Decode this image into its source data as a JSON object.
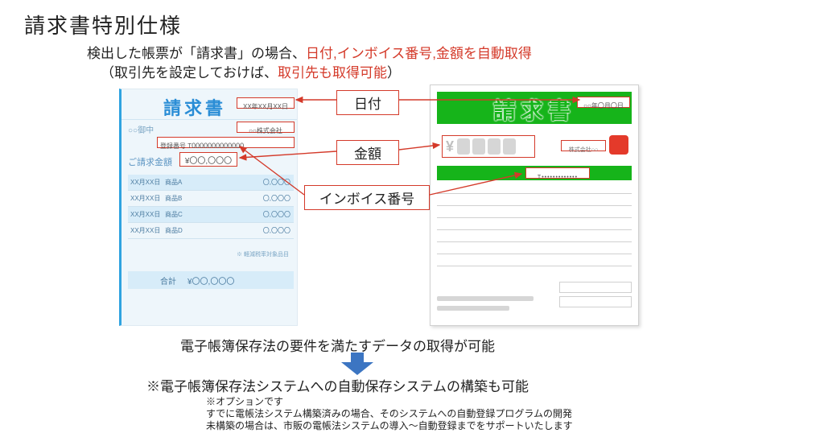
{
  "title": "請求書特別仕様",
  "intro": {
    "line1_pre": "検出した帳票が「請求書」の場合、",
    "line1_red": "日付,インボイス番号,金額を自動取得",
    "line2_pre": "（取引先を設定しておけば、",
    "line2_red": "取引先も取得可能",
    "line2_post": "）"
  },
  "labels": {
    "date": "日付",
    "amount": "金額",
    "invoice_no": "インボイス番号"
  },
  "blue": {
    "title": "請求書",
    "addressee": "○○御中",
    "date": "XX年XX月XX日",
    "company": "○○株式会社",
    "reg_prefix": "登録番号 T",
    "reg_number": "0000000000000",
    "billed_label": "ご請求金額",
    "billed_amount": "¥〇〇,〇〇〇",
    "rows": [
      {
        "date": "XX月XX日",
        "item": "商品A",
        "amt": "〇,〇〇〇"
      },
      {
        "date": "XX月XX日",
        "item": "商品B",
        "amt": "〇,〇〇〇"
      },
      {
        "date": "XX月XX日",
        "item": "商品C",
        "amt": "〇,〇〇〇"
      },
      {
        "date": "XX月XX日",
        "item": "商品D",
        "amt": "〇,〇〇〇"
      }
    ],
    "note": "※ 軽減税率対象品目",
    "total_label": "合計",
    "total": "¥〇〇,〇〇〇"
  },
  "green": {
    "title": "請求書",
    "date": "○○年〇月〇日",
    "company": "株式会社○○",
    "yen": "¥",
    "invoice_dots": "T•••••••••••••"
  },
  "footer": {
    "line1": "電子帳簿保存法の要件を満たすデータの取得が可能",
    "line2": "※電子帳簿保存法システムへの自動保存システムの構築も可能",
    "opt": "※オプションです",
    "opt_l2": "すでに電帳法システム構築済みの場合、そのシステムへの自動登録プログラムの開発",
    "opt_l3": "未構築の場合は、市販の電帳法システムの導入～自動登録までをサポートいたします"
  },
  "colors": {
    "red": "#d43a2a",
    "blue": "#2a8dd6",
    "green": "#16b41a"
  }
}
